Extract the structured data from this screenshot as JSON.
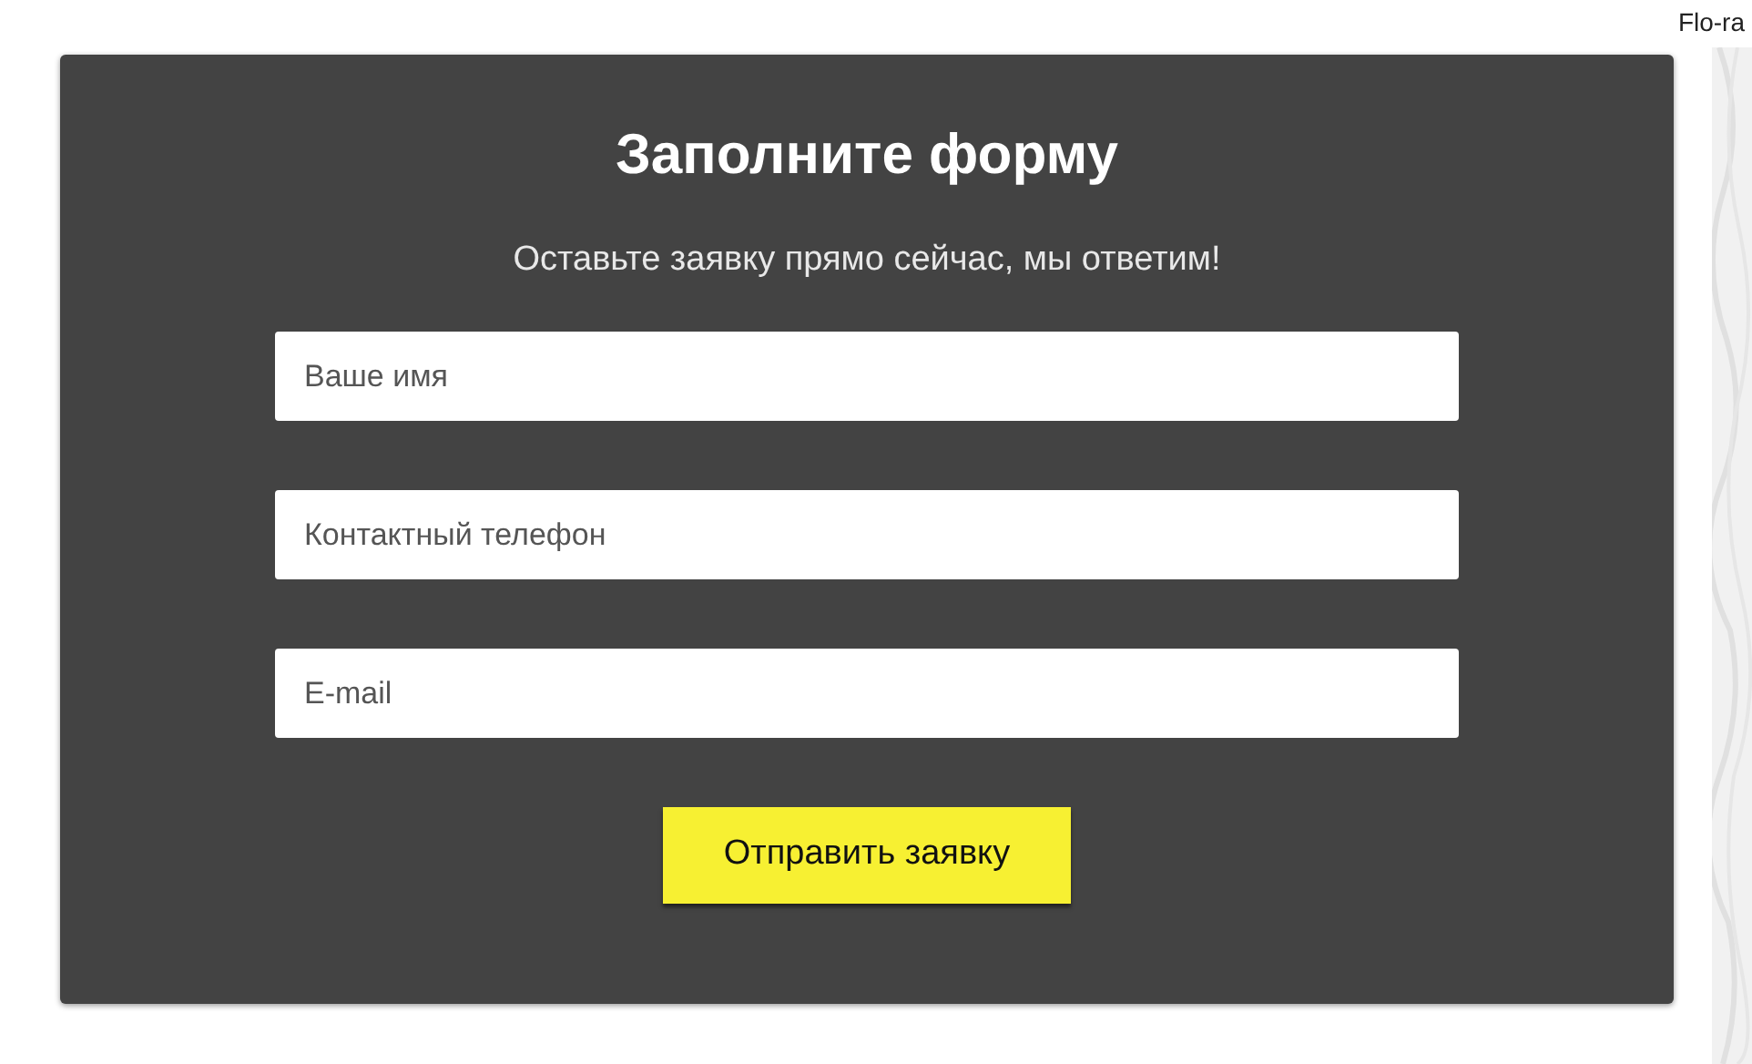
{
  "header": {
    "site_name": "Flo-ra"
  },
  "form": {
    "title": "Заполните форму",
    "subtitle": "Оставьте заявку прямо сейчас, мы ответим!",
    "fields": [
      {
        "placeholder": "Ваше имя"
      },
      {
        "placeholder": "Контактный телефон"
      },
      {
        "placeholder": "E-mail"
      }
    ],
    "submit": "Отправить заявку"
  }
}
